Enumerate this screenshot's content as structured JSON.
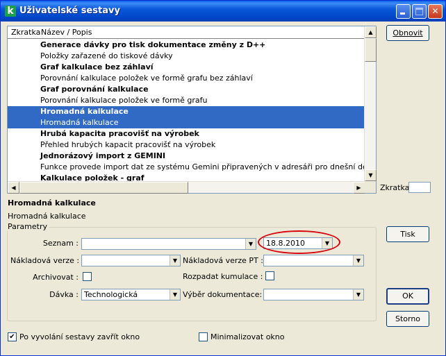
{
  "window": {
    "title": "Uživatelské sestavy",
    "app_icon_letter": "k"
  },
  "list": {
    "columns": [
      "Zkratka",
      "Název / Popis"
    ],
    "rows": [
      {
        "text": "Generace dávky pro tisk dokumentace změny z D++",
        "bold": true
      },
      {
        "text": "Položky zařazené do tiskové dávky",
        "bold": false
      },
      {
        "text": "Graf kalkulace bez záhlaví",
        "bold": true
      },
      {
        "text": "Porovnání kalkulace položek ve formě grafu bez záhlaví",
        "bold": false
      },
      {
        "text": "Graf porovnání kalkulace",
        "bold": true
      },
      {
        "text": "Porovnání kalkulace položek ve formě grafu",
        "bold": false
      },
      {
        "text": "Hromadná kalkulace",
        "bold": true,
        "selected": true
      },
      {
        "text": "Hromadná kalkulace",
        "bold": false,
        "selected": true
      },
      {
        "text": "Hrubá kapacita pracovišť na výrobek",
        "bold": true
      },
      {
        "text": "Přehled hrubých kapacit pracovišť na výrobek",
        "bold": false
      },
      {
        "text": "Jednorázový import z GEMINI",
        "bold": true
      },
      {
        "text": "Funkce provede import dat ze systému Gemini připravených v adresáři pro dnešní den",
        "bold": false
      },
      {
        "text": "Kalkulace položek - graf",
        "bold": true
      }
    ]
  },
  "buttons": {
    "refresh": "Obnovit",
    "print": "Tisk",
    "ok": "OK",
    "cancel": "Storno"
  },
  "shortcut": {
    "label": "Zkratka:",
    "value": ""
  },
  "selected": {
    "title": "Hromadná kalkulace",
    "description": "Hromadná kalkulace"
  },
  "params": {
    "legend": "Parametry",
    "seznam_label": "Seznam :",
    "seznam_value": "",
    "date_value": "18.8.2010",
    "nakladova_verze_label": "Nákladová verze :",
    "nakladova_verze_value": "",
    "nakladova_verze_pt_label": "Nákladová verze PT :",
    "nakladova_verze_pt_value": "",
    "archivovat_label": "Archivovat :",
    "archivovat_checked": false,
    "rozpadat_label": "Rozpadat kumulace :",
    "rozpadat_checked": false,
    "davka_label": "Dávka :",
    "davka_value": "Technologická",
    "vyber_label": "Výběr dokumentace:",
    "vyber_value": ""
  },
  "options": {
    "close_after_label": "Po vyvolání sestavy zavřít okno",
    "close_after_checked": true,
    "minimize_label": "Minimalizovat okno",
    "minimize_checked": false
  },
  "highlight_color": "#d8000c",
  "selection_color": "#316ac5"
}
